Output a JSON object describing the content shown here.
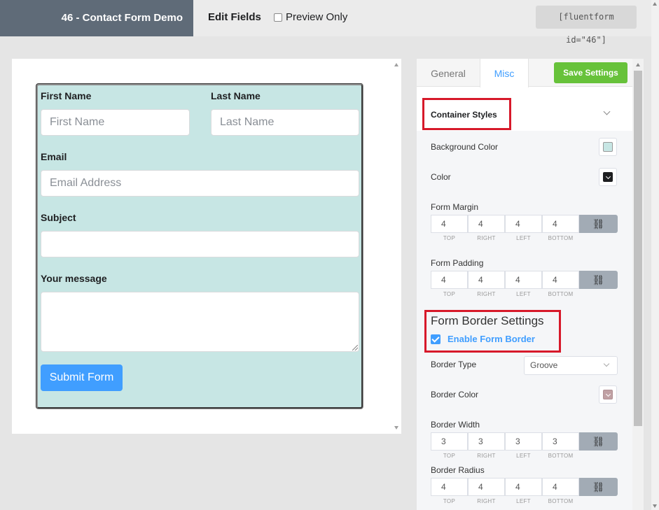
{
  "topbar": {
    "form_title": "46 - Contact Form Demo",
    "edit_fields": "Edit Fields",
    "preview_only": "Preview Only",
    "shortcode": "[fluentform id=\"46\"]"
  },
  "form": {
    "first_name_label": "First Name",
    "first_name_placeholder": "First Name",
    "last_name_label": "Last Name",
    "last_name_placeholder": "Last Name",
    "email_label": "Email",
    "email_placeholder": "Email Address",
    "subject_label": "Subject",
    "subject_value": "",
    "message_label": "Your message",
    "message_value": "",
    "submit_label": "Submit Form",
    "background_color": "#c7e6e4",
    "submit_color": "#409eff"
  },
  "settings": {
    "tabs": [
      {
        "label": "General",
        "active": false
      },
      {
        "label": "Misc",
        "active": true
      }
    ],
    "save_label": "Save Settings",
    "container_styles_title": "Container Styles",
    "background_color_label": "Background Color",
    "background_color_value": "#c7e6e4",
    "color_label": "Color",
    "color_value": "#1e1f21",
    "form_margin_label": "Form Margin",
    "form_margin": [
      "4",
      "4",
      "4",
      "4"
    ],
    "form_padding_label": "Form Padding",
    "form_padding": [
      "4",
      "4",
      "4",
      "4"
    ],
    "side_captions": [
      "TOP",
      "RIGHT",
      "LEFT",
      "BOTTOM"
    ],
    "form_border_title": "Form Border Settings",
    "enable_border_label": "Enable Form Border",
    "border_type_label": "Border Type",
    "border_type_value": "Groove",
    "border_color_label": "Border Color",
    "border_color_value": "#c0a0a3",
    "border_width_label": "Border Width",
    "border_width": [
      "3",
      "3",
      "3",
      "3"
    ],
    "border_radius_label": "Border Radius",
    "border_radius": [
      "4",
      "4",
      "4",
      "4"
    ],
    "highlight_color": "#d7192a",
    "link_icon": "link-icon"
  }
}
